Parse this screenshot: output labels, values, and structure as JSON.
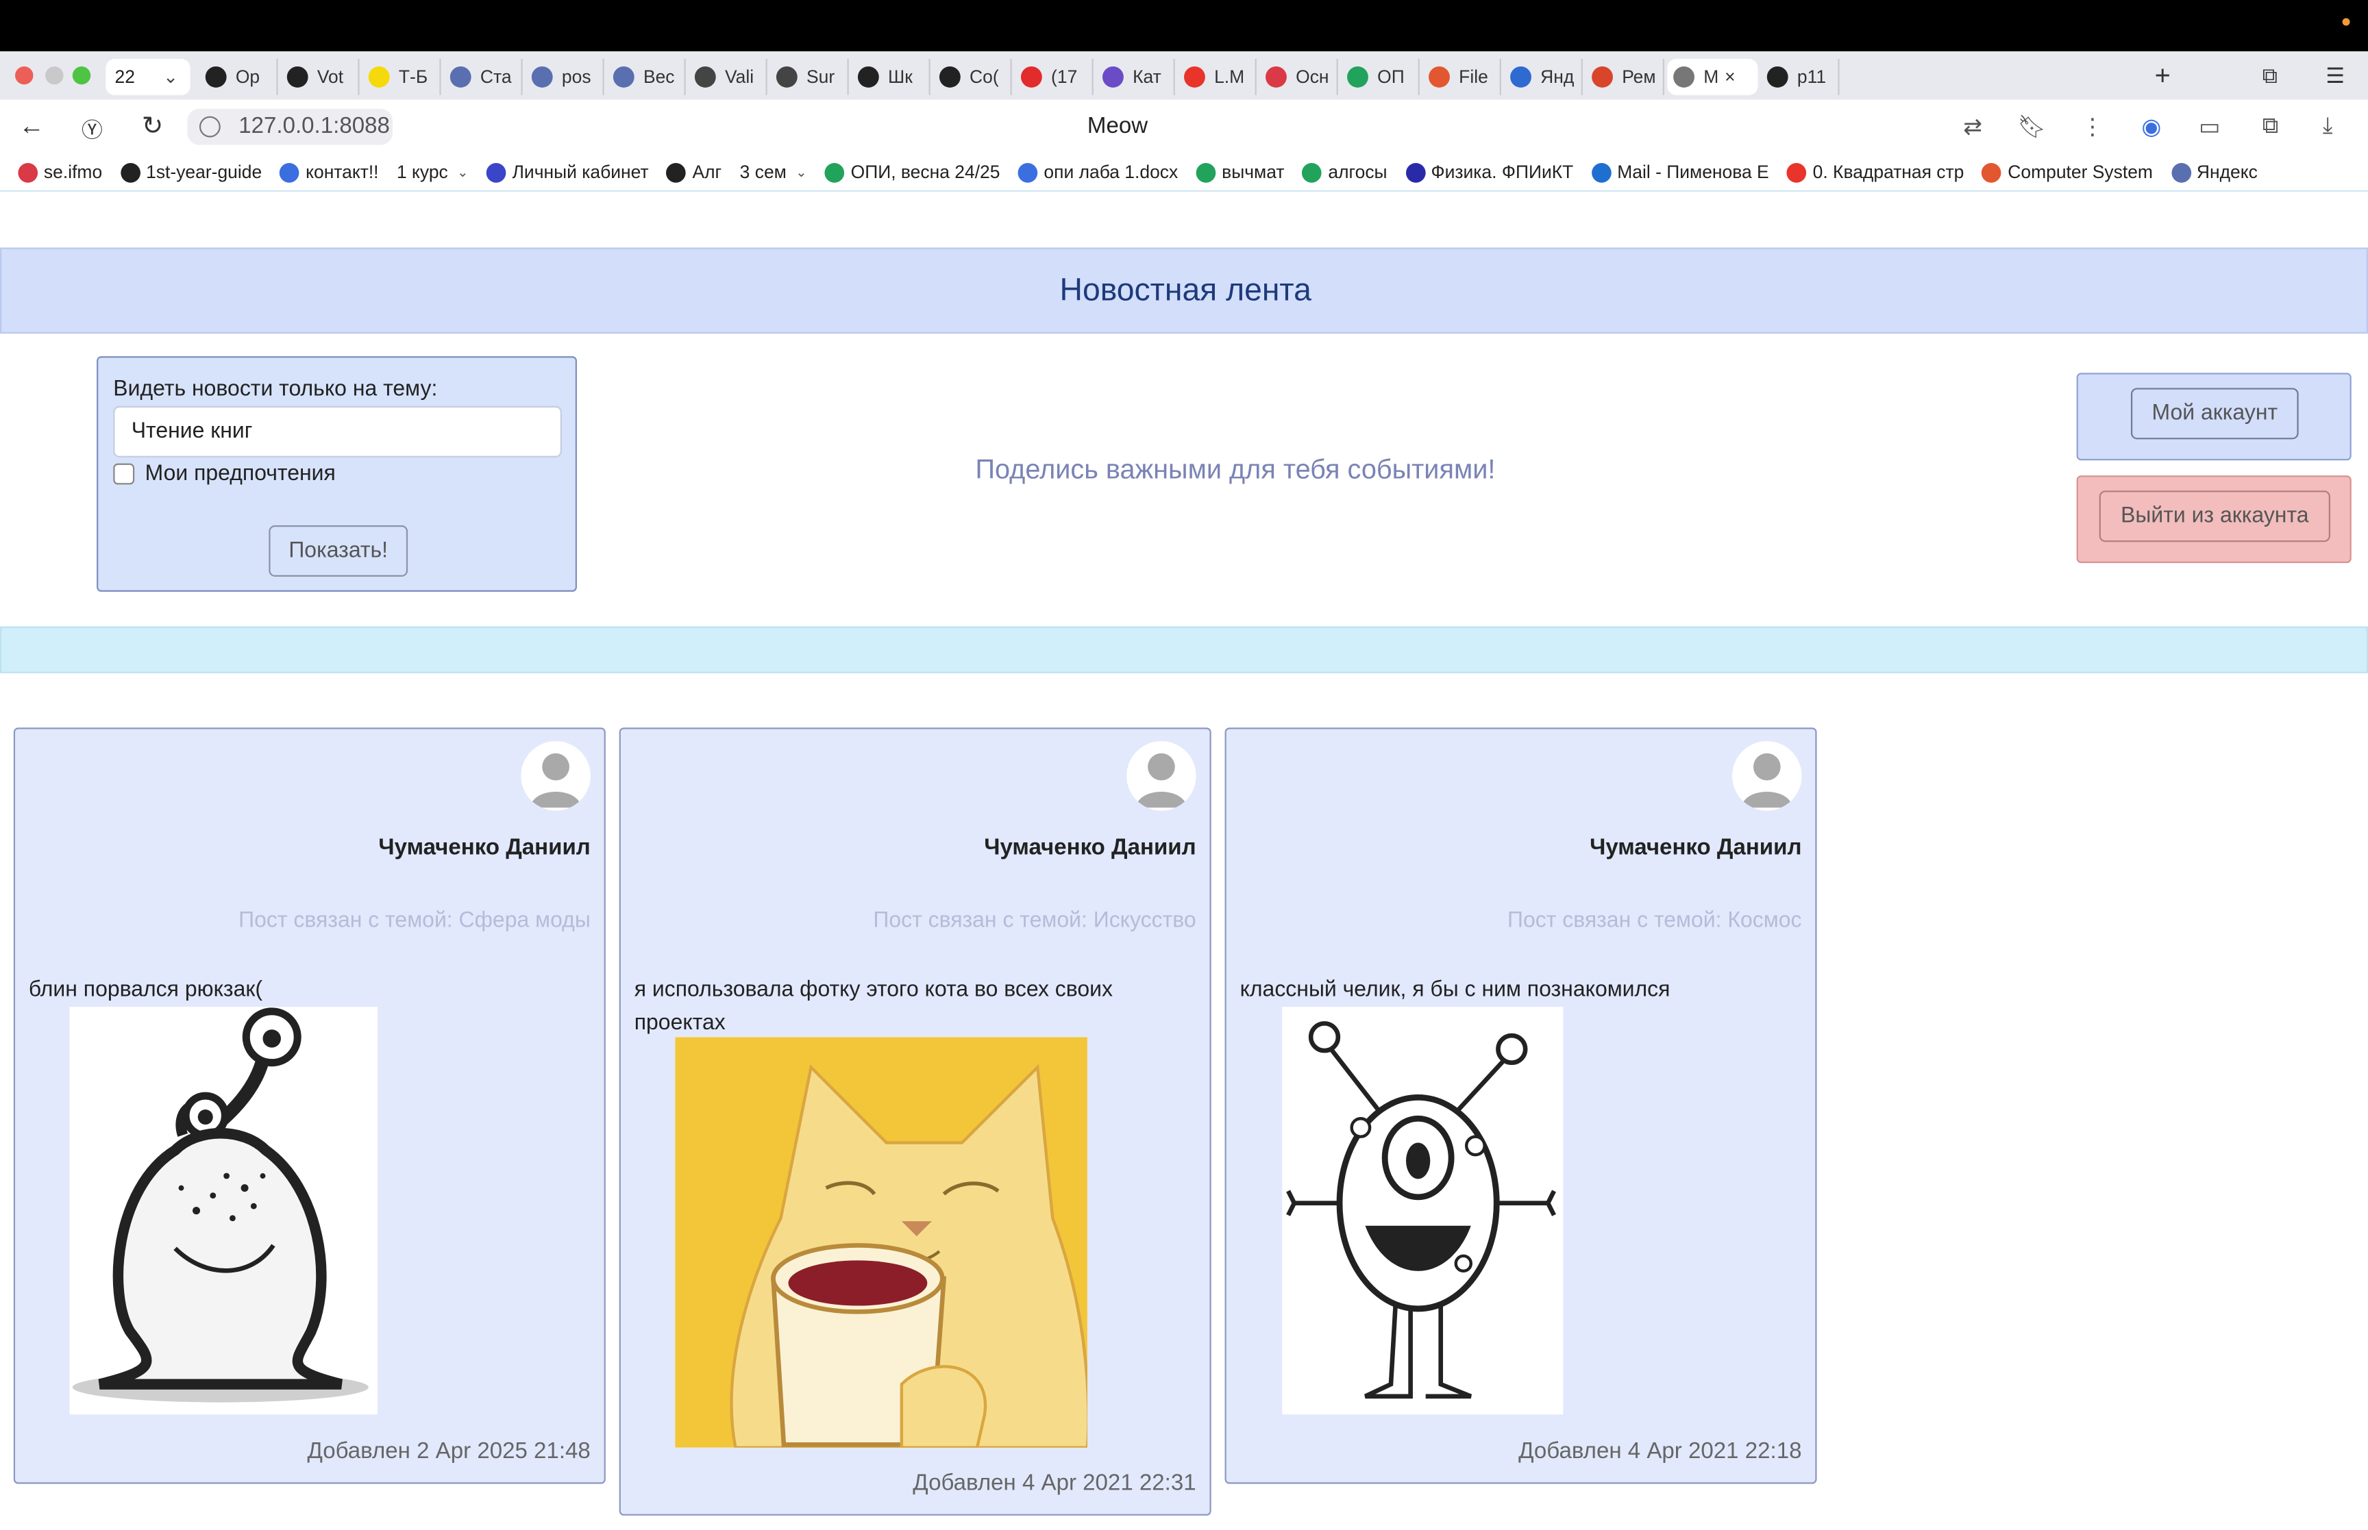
{
  "browser": {
    "tab_count": "22",
    "tabs": [
      {
        "label": "Op",
        "color": "#222222"
      },
      {
        "label": "Vot",
        "color": "#222222"
      },
      {
        "label": "Т-Б",
        "color": "#f5d90a"
      },
      {
        "label": "Ста",
        "color": "#5a6fb0"
      },
      {
        "label": "pos",
        "color": "#5a6fb0"
      },
      {
        "label": "Вес",
        "color": "#5a6fb0"
      },
      {
        "label": "Vali",
        "color": "#444444"
      },
      {
        "label": "Sur",
        "color": "#444444"
      },
      {
        "label": "Шк",
        "color": "#222222"
      },
      {
        "label": "Co(",
        "color": "#222222"
      },
      {
        "label": "(17",
        "color": "#e22b2b"
      },
      {
        "label": "Кат",
        "color": "#6a4cc7"
      },
      {
        "label": "L.М",
        "color": "#e8342a"
      },
      {
        "label": "Осн",
        "color": "#d93a45"
      },
      {
        "label": "ОП",
        "color": "#21a35b"
      },
      {
        "label": "File",
        "color": "#e2572f"
      },
      {
        "label": "Янд",
        "color": "#2f6ad1"
      },
      {
        "label": "Рем",
        "color": "#d9452b"
      },
      {
        "label": "М",
        "color": "#777777",
        "active": true
      },
      {
        "label": "p11",
        "color": "#222222"
      }
    ],
    "url": "127.0.0.1:8088",
    "page_title": "Meow",
    "bookmarks": [
      {
        "label": "se.ifmo",
        "color": "#d93a45"
      },
      {
        "label": "1st-year-guide",
        "color": "#222222"
      },
      {
        "label": "контакт!!",
        "color": "#3b6fe0"
      },
      {
        "label": "1 курс",
        "color": "",
        "dropdown": true
      },
      {
        "label": "Личный кабинет",
        "color": "#3a46c7"
      },
      {
        "label": "Алг",
        "color": "#222222"
      },
      {
        "label": "3 сем",
        "color": "",
        "dropdown": true
      },
      {
        "label": "ОПИ, весна 24/25",
        "color": "#21a35b"
      },
      {
        "label": "опи лаба 1.docx",
        "color": "#3b6fe0"
      },
      {
        "label": "вычмат",
        "color": "#21a35b"
      },
      {
        "label": "алгосы",
        "color": "#21a35b"
      },
      {
        "label": "Физика. ФПИиКТ",
        "color": "#2a2aa8"
      },
      {
        "label": "Mail - Пименова Е",
        "color": "#1f6fd1"
      },
      {
        "label": "0. Квадратная стр",
        "color": "#e8342a"
      },
      {
        "label": "Computer System",
        "color": "#e2572f"
      },
      {
        "label": "Яндекс",
        "color": "#5a6fb0"
      }
    ]
  },
  "page": {
    "heading": "Новостная лента",
    "filter": {
      "label": "Видеть новости только на тему:",
      "topic_value": "Чтение книг",
      "preferences_label": "Мои предпочтения",
      "show_button": "Показать!"
    },
    "slogan": "Поделись важными для тебя событиями!",
    "account_button": "Мой аккаунт",
    "logout_button": "Выйти из аккаунта"
  },
  "posts": [
    {
      "author": "Чумаченко Даниил",
      "topic": "Пост связан с темой: Сфера моды",
      "text": "блин порвался рюкзак(",
      "image": "alien-drawing",
      "date": "Добавлен 2 Apr 2025 21:48"
    },
    {
      "author": "Чумаченко Даниил",
      "topic": "Пост связан с темой: Искусство",
      "text": "я использовала фотку этого кота во всех своих проектах",
      "image": "cat-with-cup",
      "date": "Добавлен 4 Apr 2021 22:31"
    },
    {
      "author": "Чумаченко Даниил",
      "topic": "Пост связан с темой: Космос",
      "text": "классный челик, я бы с ним познакомился",
      "image": "one-eyed-monster",
      "date": "Добавлен 4 Apr 2021 22:18"
    }
  ]
}
